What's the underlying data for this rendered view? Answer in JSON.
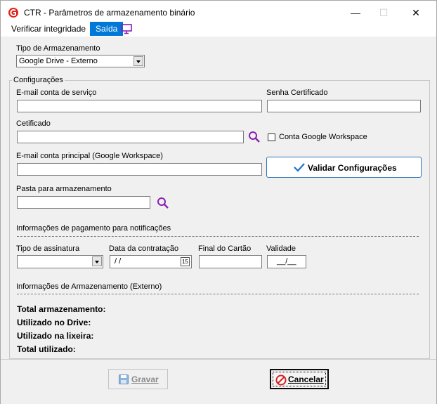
{
  "window": {
    "title": "CTR - Parâmetros de armazenamento binário",
    "minimize": "—",
    "maximize": "☐",
    "close": "✕"
  },
  "menu": {
    "verify": "Verificar integridade",
    "exit": "Saída"
  },
  "storage_type": {
    "label": "Tipo de Armazenamento",
    "selected": "Google Drive - Externo"
  },
  "config": {
    "group_title": "Configurações",
    "service_email_label": "E-mail conta de serviço",
    "service_email_value": "",
    "cert_password_label": "Senha Certificado",
    "cert_password_value": "",
    "certificate_label": "Cetificado",
    "certificate_value": "",
    "workspace_checkbox_label": "Conta Google Workspace",
    "workspace_checked": false,
    "main_email_label": "E-mail conta principal (Google Workspace)",
    "main_email_value": "",
    "validate_button": "Validar Configurações",
    "folder_label": "Pasta para armazenamento",
    "folder_value": ""
  },
  "payment": {
    "section_label": "Informações de pagamento para notificações",
    "subscription_label": "Tipo de assinatura",
    "subscription_value": "",
    "contract_date_label": "Data da contratação",
    "contract_date_value": " / /",
    "calendar_day": "15",
    "card_end_label": "Final do Cartão",
    "card_end_value": "",
    "validity_label": "Validade",
    "validity_value": "__/__"
  },
  "storage_info": {
    "section_label": "Informações de Armazenamento (Externo)",
    "total": "Total armazenamento:",
    "used_drive": "Utilizado no Drive:",
    "used_trash": "Utilizado na lixeira:",
    "total_used": "Total utilizado:"
  },
  "footer": {
    "save": "Gravar",
    "cancel": "Cancelar"
  },
  "colors": {
    "accent": "#0078d7",
    "purple": "#8a1fb5",
    "check": "#1a73c8",
    "cancel_red": "#d9201f"
  }
}
